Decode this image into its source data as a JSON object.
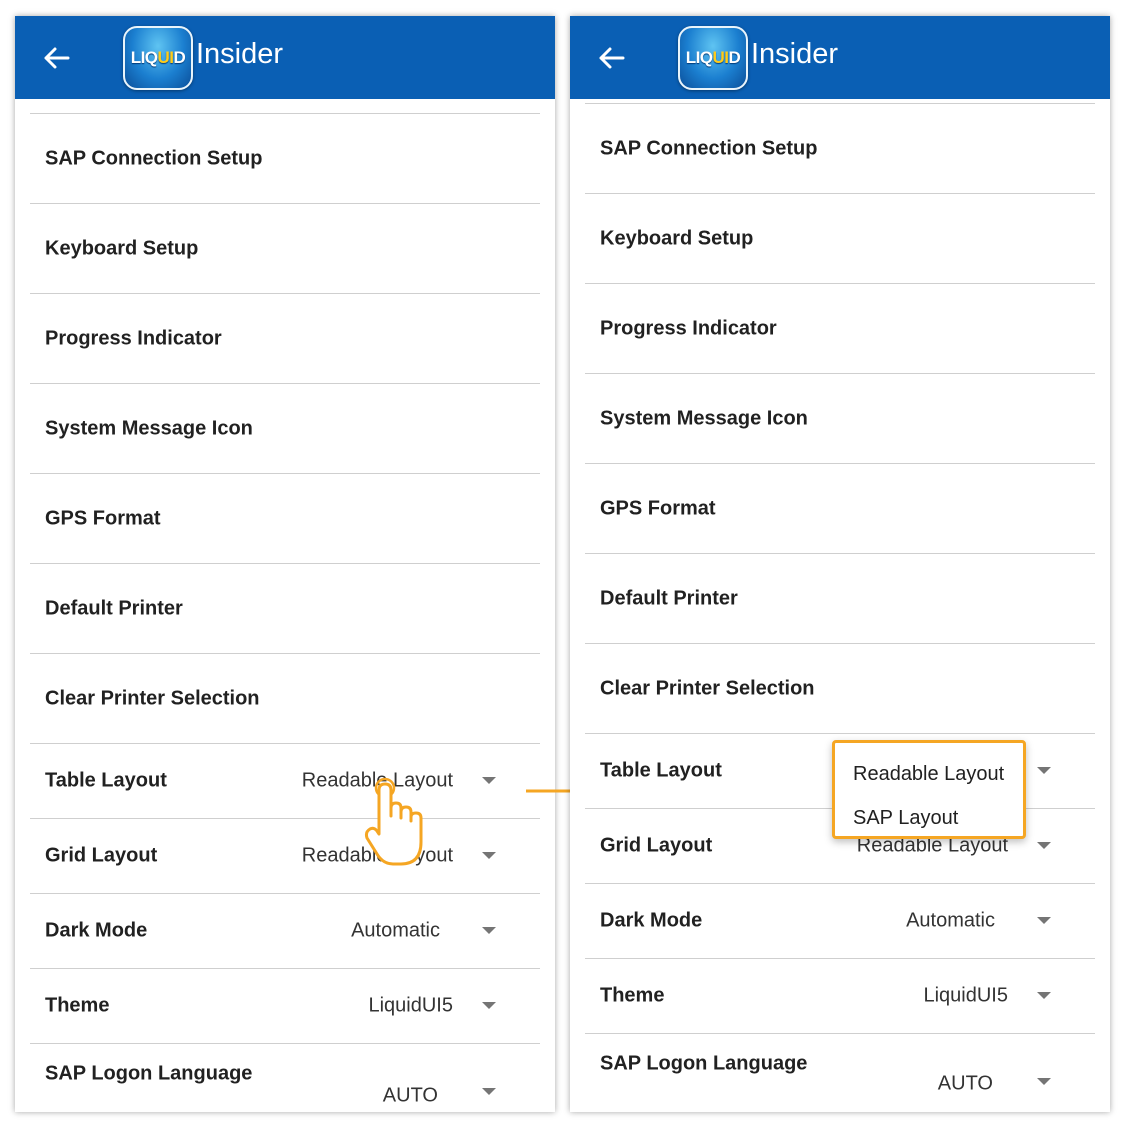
{
  "app": {
    "logo_text_1": "LIQ",
    "logo_text_2": "UI",
    "logo_text_3": "D",
    "title": "Insider"
  },
  "colors": {
    "appbar": "#0a5fb4",
    "highlight": "#f5a623",
    "divider": "#cfcfcf"
  },
  "settings": [
    "SAP Connection Setup",
    "Keyboard Setup",
    "Progress Indicator",
    "System Message Icon",
    "GPS Format",
    "Default Printer",
    "Clear Printer Selection"
  ],
  "selects": [
    {
      "label": "Table Layout",
      "value": "Readable Layout"
    },
    {
      "label": "Grid Layout",
      "value": "Readable Layout"
    },
    {
      "label": "Dark Mode",
      "value": "Automatic"
    },
    {
      "label": "Theme",
      "value": "LiquidUI5"
    },
    {
      "label": "SAP Logon Language",
      "value": "AUTO"
    }
  ],
  "dropdown_options": [
    "Readable Layout",
    "SAP Layout"
  ],
  "icons": {
    "back": "arrow-left-icon",
    "tap": "hand-pointer-icon",
    "connector": "arrow-right-icon",
    "caret": "caret-down-icon"
  }
}
